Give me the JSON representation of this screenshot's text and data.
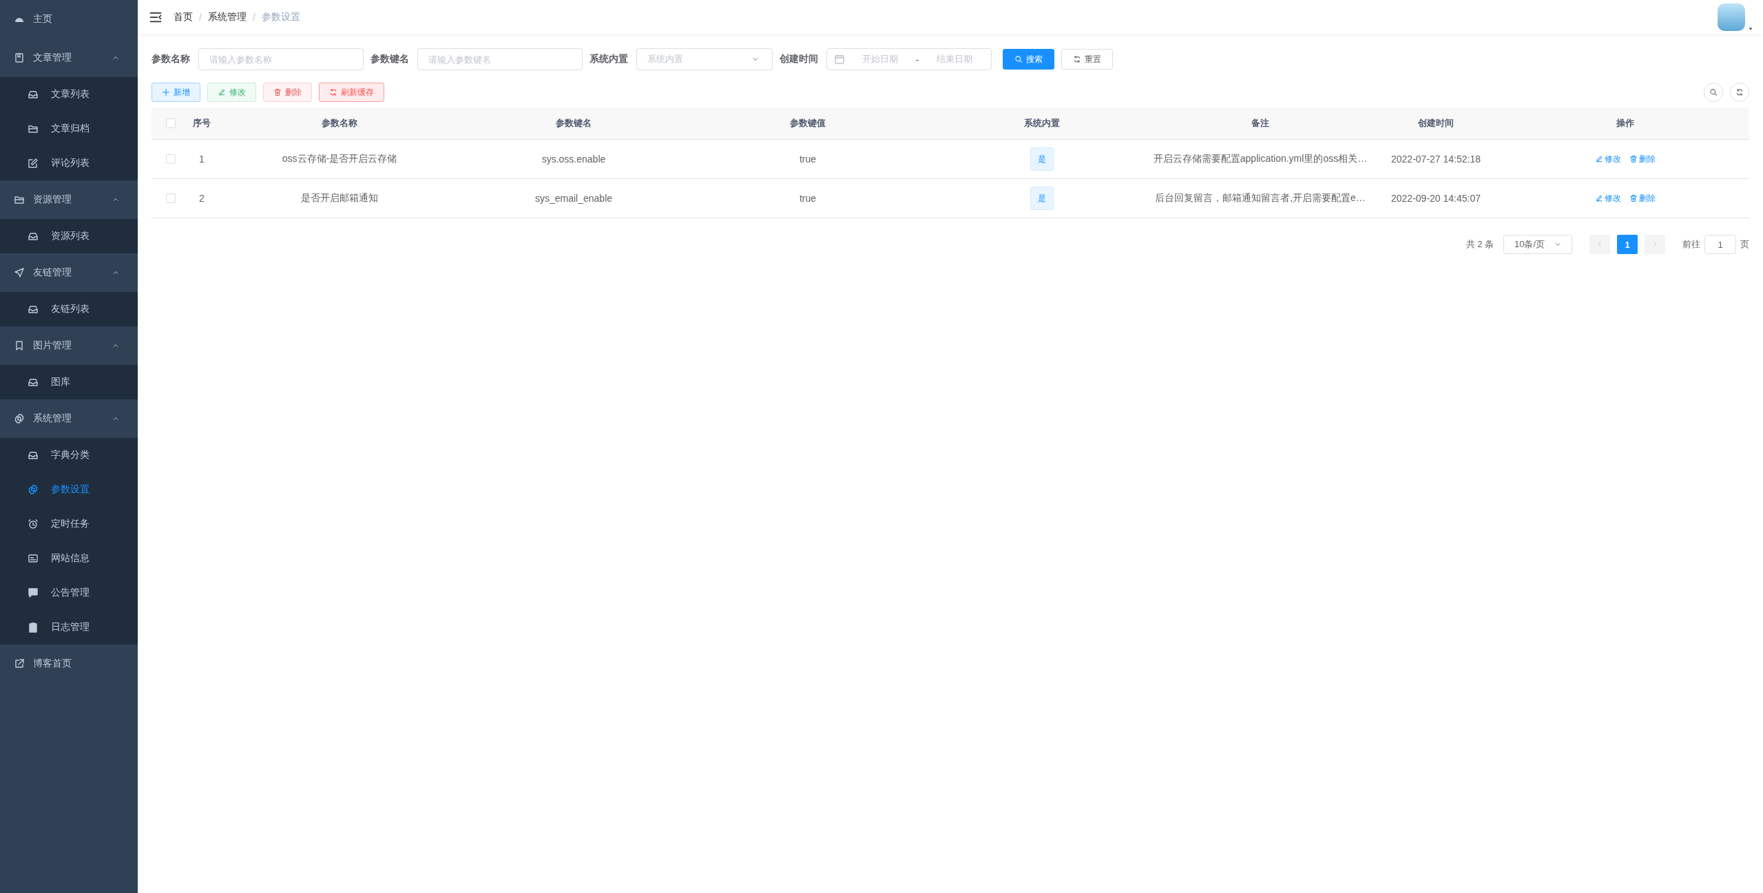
{
  "sidebar": {
    "items": [
      {
        "kind": "link",
        "label": "主页",
        "selected": false
      },
      {
        "kind": "group",
        "label": "文章管理",
        "expanded": true,
        "children": [
          {
            "label": "文章列表",
            "selected": false
          },
          {
            "label": "文章归档",
            "selected": false
          },
          {
            "label": "评论列表",
            "selected": false
          }
        ]
      },
      {
        "kind": "group",
        "label": "资源管理",
        "expanded": true,
        "children": [
          {
            "label": "资源列表",
            "selected": false
          }
        ]
      },
      {
        "kind": "group",
        "label": "友链管理",
        "expanded": true,
        "children": [
          {
            "label": "友链列表",
            "selected": false
          }
        ]
      },
      {
        "kind": "group",
        "label": "图片管理",
        "expanded": true,
        "children": [
          {
            "label": "图库",
            "selected": false
          }
        ]
      },
      {
        "kind": "group",
        "label": "系统管理",
        "expanded": true,
        "children": [
          {
            "label": "字典分类",
            "selected": false
          },
          {
            "label": "参数设置",
            "selected": true
          },
          {
            "label": "定时任务",
            "selected": false
          },
          {
            "label": "网站信息",
            "selected": false
          },
          {
            "label": "公告管理",
            "selected": false
          },
          {
            "label": "日志管理",
            "selected": false
          }
        ]
      },
      {
        "kind": "link",
        "label": "博客首页",
        "selected": false
      }
    ]
  },
  "breadcrumb": {
    "separator": "/",
    "items": [
      "首页",
      "系统管理",
      "参数设置"
    ]
  },
  "filters": [
    {
      "kind": "text",
      "label": "参数名称",
      "placeholder": "请输入参数名称"
    },
    {
      "kind": "text",
      "label": "参数键名",
      "placeholder": "请输入参数键名"
    },
    {
      "kind": "select",
      "label": "系统内置",
      "placeholder": "系统内置"
    },
    {
      "kind": "daterange",
      "label": "创建时间",
      "start_placeholder": "开始日期",
      "separator": "-",
      "end_placeholder": "结束日期"
    }
  ],
  "search_button": "搜索",
  "reset_button": "重置",
  "actions": [
    {
      "kind": "primary",
      "label": "新增",
      "disabled": false
    },
    {
      "kind": "success",
      "label": "修改",
      "disabled": true
    },
    {
      "kind": "danger",
      "label": "删除",
      "disabled": true
    },
    {
      "kind": "warning",
      "label": "刷新缓存",
      "disabled": false
    }
  ],
  "table": {
    "all_selected": false,
    "columns": [
      "序号",
      "参数名称",
      "参数键名",
      "参数键值",
      "系统内置",
      "备注",
      "创建时间",
      "操作"
    ],
    "rows": [
      {
        "selected": false,
        "index": "1",
        "name": "oss云存储-是否开启云存储",
        "key": "sys.oss.enable",
        "value": "true",
        "builtin": "是",
        "remark": "开启云存储需要配置application.yml里的oss相关…",
        "created": "2022-07-27 14:52:18",
        "actions": [
          "修改",
          "删除"
        ]
      },
      {
        "selected": false,
        "index": "2",
        "name": "是否开启邮箱通知",
        "key": "sys_email_enable",
        "value": "true",
        "builtin": "是",
        "remark": "后台回复留言，邮箱通知留言者,开启需要配置e…",
        "created": "2022-09-20 14:45:07",
        "actions": [
          "修改",
          "删除"
        ]
      }
    ]
  },
  "pagination": {
    "total": "共 2 条",
    "page_size": "10条/页",
    "pages": [
      {
        "label": "1",
        "selected": true
      }
    ],
    "goto_label": "前往",
    "goto_value": "1",
    "goto_suffix": "页"
  }
}
